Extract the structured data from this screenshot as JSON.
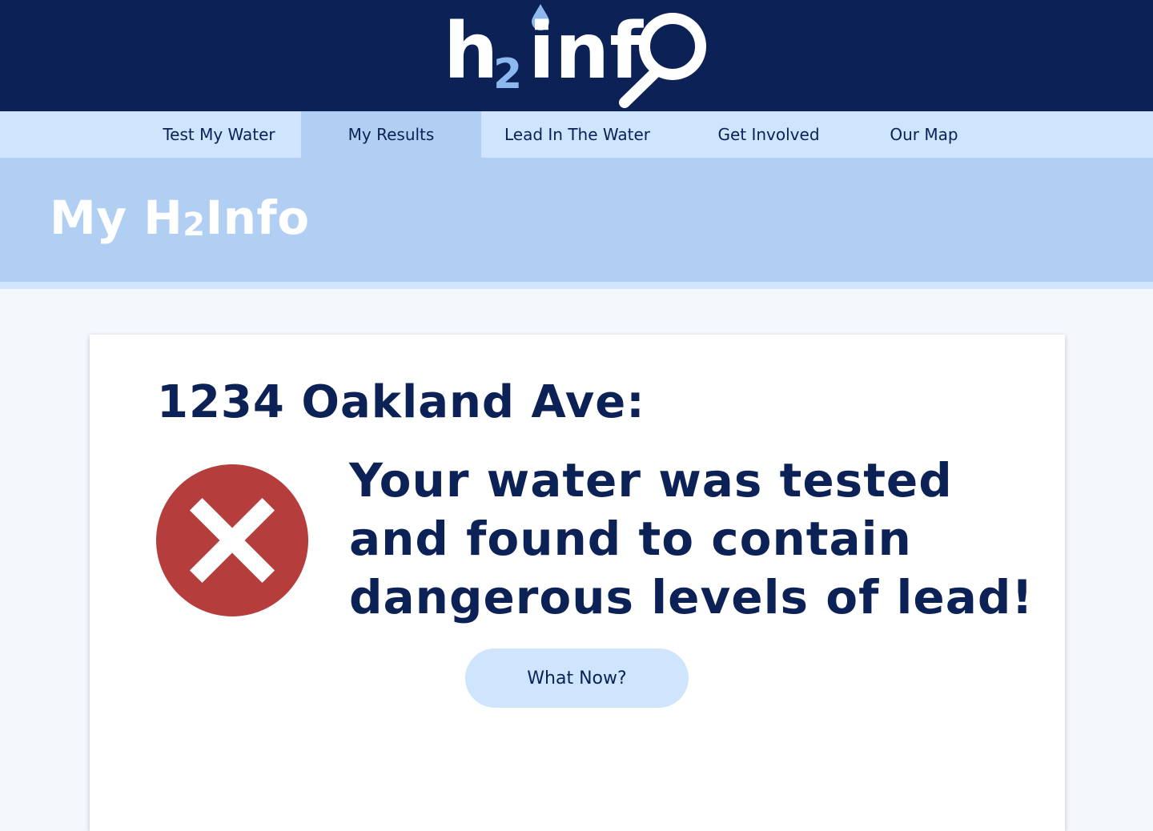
{
  "brand": {
    "logo_h": "h",
    "logo_sub": "2",
    "logo_inf": "inf",
    "colors": {
      "navy": "#0c2155",
      "light_blue": "#cfe4fd",
      "mid_blue": "#b1cff2",
      "accent": "#8cb8ef",
      "error_red": "#b53e3c"
    }
  },
  "nav": {
    "items": [
      {
        "label": "Test My Water",
        "active": false
      },
      {
        "label": "My Results",
        "active": true
      },
      {
        "label": "Lead In The Water",
        "active": false
      },
      {
        "label": "Get Involved",
        "active": false
      },
      {
        "label": "Our Map",
        "active": false
      }
    ]
  },
  "banner": {
    "title_prefix": "My H",
    "title_sub": "2",
    "title_suffix": "Info"
  },
  "result": {
    "address": "1234 Oakland Ave:",
    "status_icon": "error-x-icon",
    "message": "Your water was tested and found to contain dangerous levels of lead!",
    "button_label": "What Now?"
  }
}
